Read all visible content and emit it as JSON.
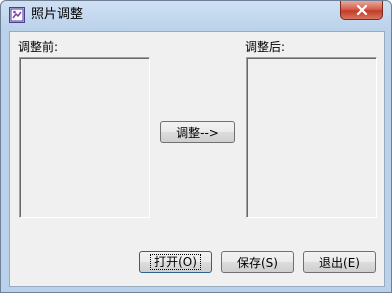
{
  "window": {
    "title": "照片调整"
  },
  "left_panel": {
    "label": "调整前:"
  },
  "right_panel": {
    "label": "调整后:"
  },
  "buttons": {
    "adjust": "调整-->",
    "open": "打开(O)",
    "save": "保存(S)",
    "exit": "退出(E)"
  },
  "icons": {
    "app": "photo-app-icon",
    "close": "close-icon"
  },
  "colors": {
    "close_button": "#c13d27",
    "titlebar": "#b9d1ea",
    "client_bg": "#f0f0f0"
  }
}
